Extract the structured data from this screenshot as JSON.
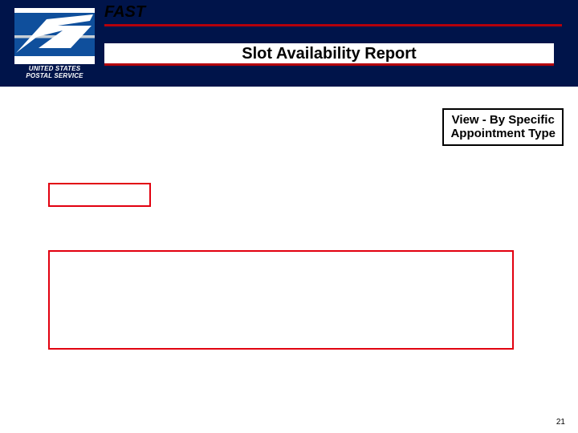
{
  "brand": {
    "app_name": "FAST",
    "org_line1": "UNITED STATES",
    "org_line2": "POSTAL SERVICE"
  },
  "report_title": "Slot Availability Report",
  "callout": {
    "line1": "View - By Specific",
    "line2": "Appointment Type"
  },
  "page_number": "21",
  "colors": {
    "banner": "#00144a",
    "rule": "#b4000b",
    "highlight": "#e2000f"
  }
}
